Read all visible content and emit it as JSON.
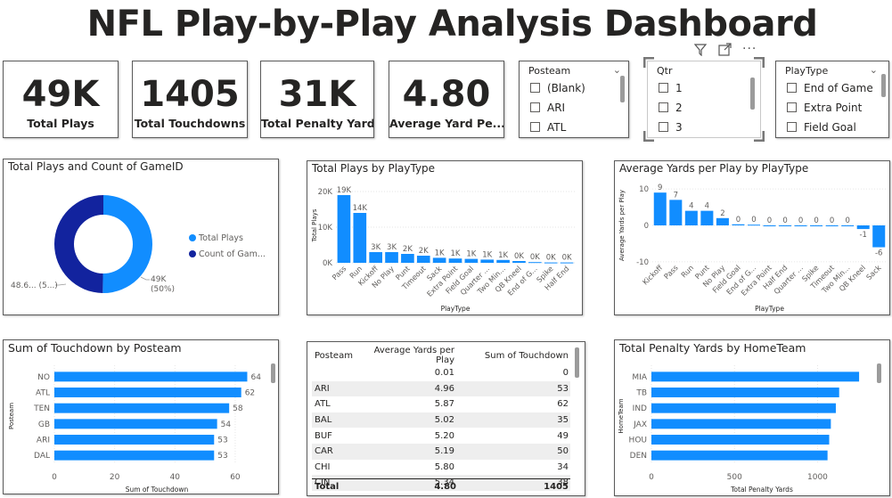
{
  "header": {
    "title": "NFL Play-by-Play Analysis Dashboard"
  },
  "kpis": [
    {
      "value": "49K",
      "label": "Total Plays"
    },
    {
      "value": "1405",
      "label": "Total Touchdowns"
    },
    {
      "value": "31K",
      "label": "Total Penalty Yards"
    },
    {
      "value": "4.80",
      "label": "Average Yard Pe..."
    }
  ],
  "slicers": {
    "posteam": {
      "title": "Posteam",
      "items": [
        "(Blank)",
        "ARI",
        "ATL"
      ]
    },
    "qtr": {
      "title": "Qtr",
      "items": [
        "1",
        "2",
        "3"
      ]
    },
    "playtype": {
      "title": "PlayType",
      "items": [
        "End of Game",
        "Extra Point",
        "Field Goal"
      ]
    }
  },
  "toolbar_icons": [
    "filter-icon",
    "focus-mode-icon",
    "more-options-icon"
  ],
  "colors": {
    "primary": "#118dff",
    "dark": "#12239e",
    "card_border": "#5a5a5a"
  },
  "donut": {
    "title": "Total Plays and Count of GameID",
    "legend": [
      "Total Plays",
      "Count of Gam..."
    ],
    "right_label": "49K",
    "right_pct": "(50%)",
    "left_label": "48.6... (5...)",
    "chart_data": {
      "type": "pie",
      "categories": [
        "Total Plays",
        "Count of GameID"
      ],
      "values": [
        49000,
        48600
      ],
      "colors": [
        "#118dff",
        "#12239e"
      ]
    }
  },
  "plays_by_type": {
    "title": "Total Plays by PlayType",
    "chart_data": {
      "type": "bar",
      "title": "Total Plays by PlayType",
      "xlabel": "PlayType",
      "ylabel": "Total Plays",
      "categories": [
        "Pass",
        "Run",
        "Kickoff",
        "No Play",
        "Punt",
        "Timeout",
        "Sack",
        "Extra Point",
        "Field Goal",
        "Quarter ...",
        "Two Min...",
        "QB Kneel",
        "End of G...",
        "Spike",
        "Half End"
      ],
      "values": [
        19000,
        14000,
        3000,
        3000,
        2500,
        2000,
        1400,
        1200,
        1100,
        900,
        800,
        500,
        200,
        100,
        100
      ],
      "data_labels": [
        "19K",
        "14K",
        "3K",
        "3K",
        "2K",
        "2K",
        "1K",
        "1K",
        "1K",
        "1K",
        "1K",
        "0K",
        "0K",
        "0K",
        "0K"
      ],
      "ylim": [
        0,
        21000
      ],
      "yticks": [
        "0K",
        "10K",
        "20K"
      ],
      "ytick_values": [
        0,
        10000,
        20000
      ]
    }
  },
  "avg_yards": {
    "title": "Average Yards per Play by PlayType",
    "chart_data": {
      "type": "bar",
      "title": "Average Yards per Play by PlayType",
      "xlabel": "PlayType",
      "ylabel": "Average Yards per Play",
      "categories": [
        "Kickoff",
        "Pass",
        "Run",
        "Punt",
        "No Play",
        "Field Goal",
        "End of G...",
        "Extra Point",
        "Half End",
        "Quarter ...",
        "Spike",
        "Timeout",
        "Two Min...",
        "QB Kneel",
        "Sack"
      ],
      "values": [
        9,
        7,
        4,
        4,
        2,
        0.3,
        0.2,
        0,
        0,
        0,
        0,
        0,
        0,
        -1,
        -6
      ],
      "data_labels": [
        "9",
        "7",
        "4",
        "4",
        "2",
        "0",
        "0",
        "0",
        "0",
        "0",
        "0",
        "0",
        "0",
        "-1",
        "-6"
      ],
      "ylim": [
        -11,
        11
      ],
      "yticks": [
        "10",
        "0",
        "-10"
      ],
      "ytick_values": [
        10,
        0,
        -10
      ]
    }
  },
  "touchdown_by_posteam": {
    "title": "Sum of Touchdown by Posteam",
    "chart_data": {
      "type": "bar",
      "orientation": "horizontal",
      "title": "Sum of Touchdown by Posteam",
      "xlabel": "Sum of Touchdown",
      "ylabel": "Posteam",
      "categories": [
        "NO",
        "ATL",
        "TEN",
        "GB",
        "ARI",
        "DAL"
      ],
      "values": [
        64,
        62,
        58,
        54,
        53,
        53
      ],
      "xlim": [
        0,
        68
      ],
      "xticks": [
        "0",
        "20",
        "40",
        "60"
      ],
      "xtick_values": [
        0,
        20,
        40,
        60
      ]
    }
  },
  "table": {
    "headers": [
      "Posteam",
      "Average Yards per Play",
      "Sum of Touchdown"
    ],
    "rows": [
      [
        "",
        "0.01",
        "0"
      ],
      [
        "ARI",
        "4.96",
        "53"
      ],
      [
        "ATL",
        "5.87",
        "62"
      ],
      [
        "BAL",
        "5.02",
        "35"
      ],
      [
        "BUF",
        "5.20",
        "49"
      ],
      [
        "CAR",
        "5.19",
        "50"
      ],
      [
        "CHI",
        "5.80",
        "34"
      ],
      [
        "CIN",
        "5.34",
        "38"
      ]
    ],
    "total": [
      "Total",
      "4.80",
      "1405"
    ]
  },
  "penalty_by_hometeam": {
    "title": "Total Penalty Yards by HomeTeam",
    "chart_data": {
      "type": "bar",
      "orientation": "horizontal",
      "title": "Total Penalty Yards by HomeTeam",
      "xlabel": "Total Penalty Yards",
      "ylabel": "HomeTeam",
      "categories": [
        "MIA",
        "TB",
        "IND",
        "JAX",
        "HOU",
        "DEN"
      ],
      "values": [
        1250,
        1130,
        1110,
        1080,
        1070,
        1060
      ],
      "xlim": [
        0,
        1330
      ],
      "xticks": [
        "0",
        "500",
        "1000"
      ],
      "xtick_values": [
        0,
        500,
        1000
      ]
    }
  }
}
